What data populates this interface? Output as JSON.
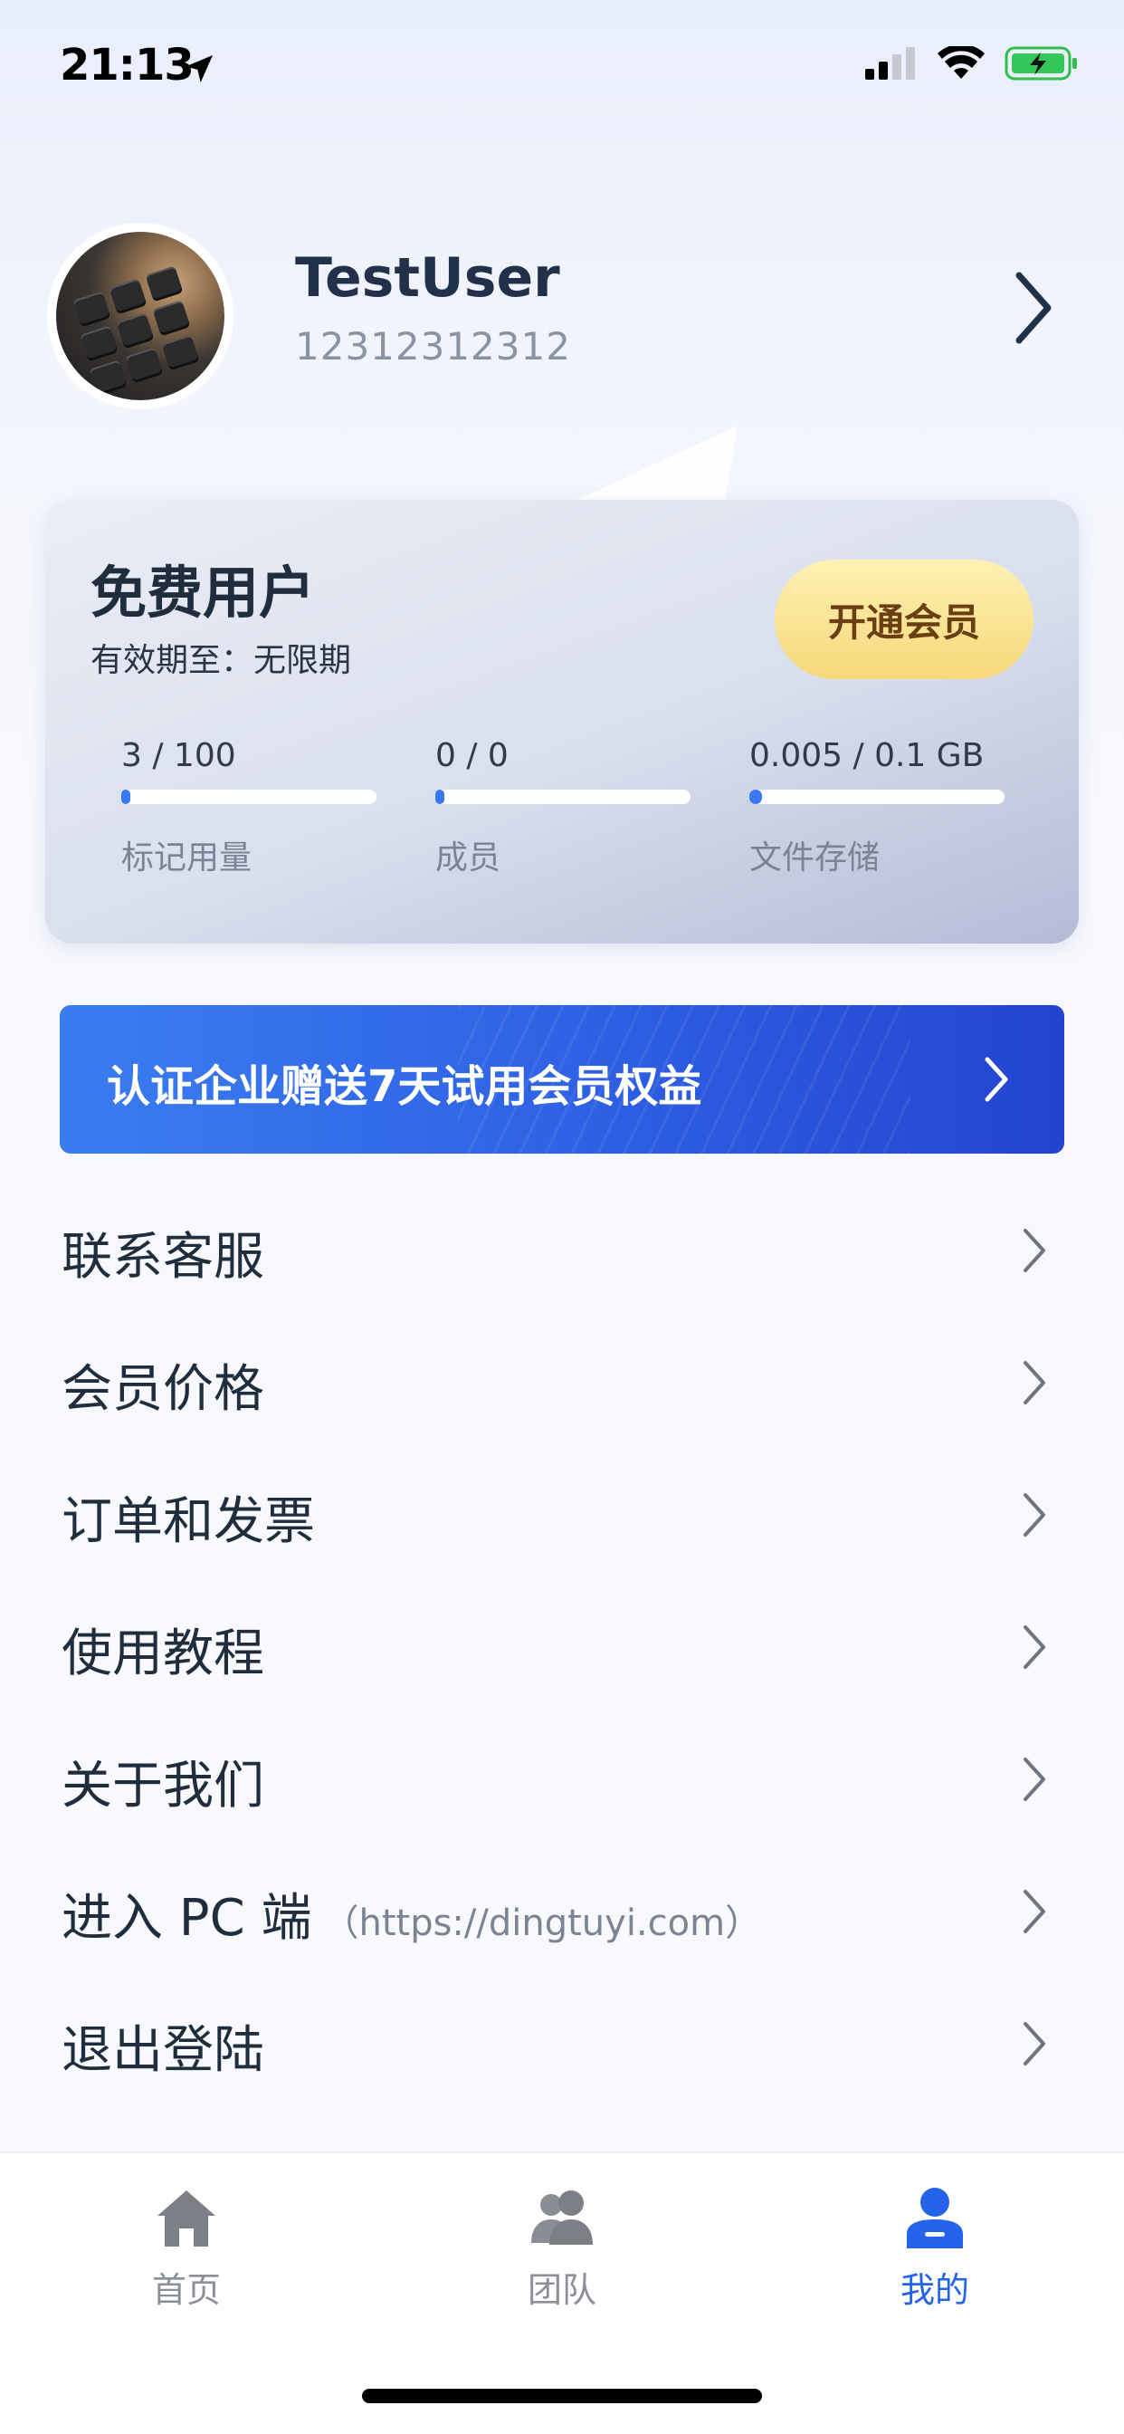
{
  "status_bar": {
    "time": "21:13",
    "icons": [
      "location-arrow-icon",
      "signal-icon",
      "wifi-icon",
      "battery-charging-icon"
    ]
  },
  "profile": {
    "name": "TestUser",
    "phone": "12312312312",
    "avatar_icon": "keyboard-photo-avatar"
  },
  "membership": {
    "tier": "免费用户",
    "validity": "有效期至：无限期",
    "upgrade_label": "开通会员",
    "stats": [
      {
        "value": "3 / 100",
        "label": "标记用量",
        "fraction": 0.03
      },
      {
        "value": "0 / 0",
        "label": "成员",
        "fraction": 0
      },
      {
        "value": "0.005 / 0.1 GB",
        "label": "文件存储",
        "fraction": 0.05
      }
    ]
  },
  "promo": {
    "text": "认证企业赠送7天试用会员权益"
  },
  "menu": [
    {
      "label": "联系客服",
      "sub": ""
    },
    {
      "label": "会员价格",
      "sub": ""
    },
    {
      "label": "订单和发票",
      "sub": ""
    },
    {
      "label": "使用教程",
      "sub": ""
    },
    {
      "label": "关于我们",
      "sub": ""
    },
    {
      "label": "进入 PC 端",
      "sub": "（https://dingtuyi.com）"
    },
    {
      "label": "退出登陆",
      "sub": ""
    }
  ],
  "tabs": [
    {
      "label": "首页",
      "icon": "home-icon",
      "active": false
    },
    {
      "label": "团队",
      "icon": "team-icon",
      "active": false
    },
    {
      "label": "我的",
      "icon": "profile-icon",
      "active": true
    }
  ],
  "colors": {
    "accent": "#2563eb",
    "upgrade_button": "#f6d879",
    "progress": "#3a78f2"
  }
}
